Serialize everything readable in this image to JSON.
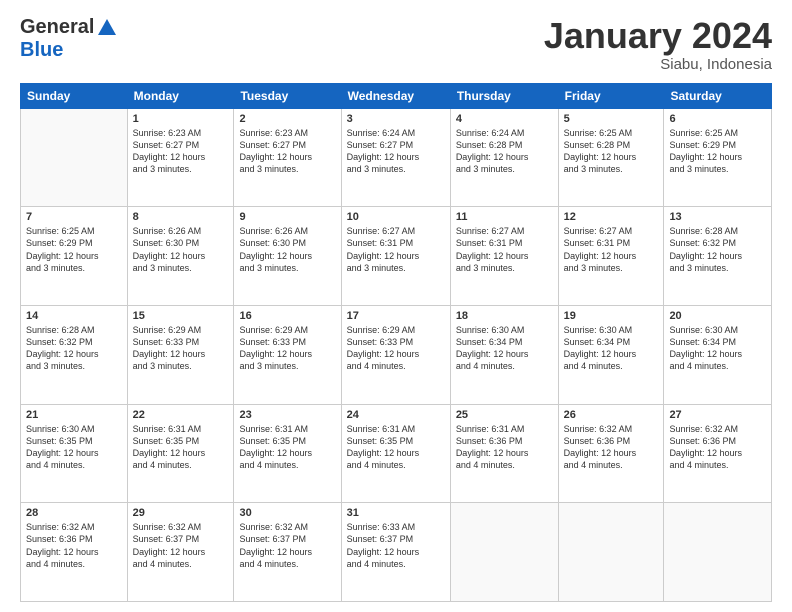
{
  "header": {
    "logo": {
      "general": "General",
      "blue": "Blue"
    },
    "title": "January 2024",
    "location": "Siabu, Indonesia"
  },
  "calendar": {
    "days_of_week": [
      "Sunday",
      "Monday",
      "Tuesday",
      "Wednesday",
      "Thursday",
      "Friday",
      "Saturday"
    ],
    "weeks": [
      [
        {
          "num": "",
          "info": ""
        },
        {
          "num": "1",
          "info": "Sunrise: 6:23 AM\nSunset: 6:27 PM\nDaylight: 12 hours\nand 3 minutes."
        },
        {
          "num": "2",
          "info": "Sunrise: 6:23 AM\nSunset: 6:27 PM\nDaylight: 12 hours\nand 3 minutes."
        },
        {
          "num": "3",
          "info": "Sunrise: 6:24 AM\nSunset: 6:27 PM\nDaylight: 12 hours\nand 3 minutes."
        },
        {
          "num": "4",
          "info": "Sunrise: 6:24 AM\nSunset: 6:28 PM\nDaylight: 12 hours\nand 3 minutes."
        },
        {
          "num": "5",
          "info": "Sunrise: 6:25 AM\nSunset: 6:28 PM\nDaylight: 12 hours\nand 3 minutes."
        },
        {
          "num": "6",
          "info": "Sunrise: 6:25 AM\nSunset: 6:29 PM\nDaylight: 12 hours\nand 3 minutes."
        }
      ],
      [
        {
          "num": "7",
          "info": "Sunrise: 6:25 AM\nSunset: 6:29 PM\nDaylight: 12 hours\nand 3 minutes."
        },
        {
          "num": "8",
          "info": "Sunrise: 6:26 AM\nSunset: 6:30 PM\nDaylight: 12 hours\nand 3 minutes."
        },
        {
          "num": "9",
          "info": "Sunrise: 6:26 AM\nSunset: 6:30 PM\nDaylight: 12 hours\nand 3 minutes."
        },
        {
          "num": "10",
          "info": "Sunrise: 6:27 AM\nSunset: 6:31 PM\nDaylight: 12 hours\nand 3 minutes."
        },
        {
          "num": "11",
          "info": "Sunrise: 6:27 AM\nSunset: 6:31 PM\nDaylight: 12 hours\nand 3 minutes."
        },
        {
          "num": "12",
          "info": "Sunrise: 6:27 AM\nSunset: 6:31 PM\nDaylight: 12 hours\nand 3 minutes."
        },
        {
          "num": "13",
          "info": "Sunrise: 6:28 AM\nSunset: 6:32 PM\nDaylight: 12 hours\nand 3 minutes."
        }
      ],
      [
        {
          "num": "14",
          "info": "Sunrise: 6:28 AM\nSunset: 6:32 PM\nDaylight: 12 hours\nand 3 minutes."
        },
        {
          "num": "15",
          "info": "Sunrise: 6:29 AM\nSunset: 6:33 PM\nDaylight: 12 hours\nand 3 minutes."
        },
        {
          "num": "16",
          "info": "Sunrise: 6:29 AM\nSunset: 6:33 PM\nDaylight: 12 hours\nand 3 minutes."
        },
        {
          "num": "17",
          "info": "Sunrise: 6:29 AM\nSunset: 6:33 PM\nDaylight: 12 hours\nand 4 minutes."
        },
        {
          "num": "18",
          "info": "Sunrise: 6:30 AM\nSunset: 6:34 PM\nDaylight: 12 hours\nand 4 minutes."
        },
        {
          "num": "19",
          "info": "Sunrise: 6:30 AM\nSunset: 6:34 PM\nDaylight: 12 hours\nand 4 minutes."
        },
        {
          "num": "20",
          "info": "Sunrise: 6:30 AM\nSunset: 6:34 PM\nDaylight: 12 hours\nand 4 minutes."
        }
      ],
      [
        {
          "num": "21",
          "info": "Sunrise: 6:30 AM\nSunset: 6:35 PM\nDaylight: 12 hours\nand 4 minutes."
        },
        {
          "num": "22",
          "info": "Sunrise: 6:31 AM\nSunset: 6:35 PM\nDaylight: 12 hours\nand 4 minutes."
        },
        {
          "num": "23",
          "info": "Sunrise: 6:31 AM\nSunset: 6:35 PM\nDaylight: 12 hours\nand 4 minutes."
        },
        {
          "num": "24",
          "info": "Sunrise: 6:31 AM\nSunset: 6:35 PM\nDaylight: 12 hours\nand 4 minutes."
        },
        {
          "num": "25",
          "info": "Sunrise: 6:31 AM\nSunset: 6:36 PM\nDaylight: 12 hours\nand 4 minutes."
        },
        {
          "num": "26",
          "info": "Sunrise: 6:32 AM\nSunset: 6:36 PM\nDaylight: 12 hours\nand 4 minutes."
        },
        {
          "num": "27",
          "info": "Sunrise: 6:32 AM\nSunset: 6:36 PM\nDaylight: 12 hours\nand 4 minutes."
        }
      ],
      [
        {
          "num": "28",
          "info": "Sunrise: 6:32 AM\nSunset: 6:36 PM\nDaylight: 12 hours\nand 4 minutes."
        },
        {
          "num": "29",
          "info": "Sunrise: 6:32 AM\nSunset: 6:37 PM\nDaylight: 12 hours\nand 4 minutes."
        },
        {
          "num": "30",
          "info": "Sunrise: 6:32 AM\nSunset: 6:37 PM\nDaylight: 12 hours\nand 4 minutes."
        },
        {
          "num": "31",
          "info": "Sunrise: 6:33 AM\nSunset: 6:37 PM\nDaylight: 12 hours\nand 4 minutes."
        },
        {
          "num": "",
          "info": ""
        },
        {
          "num": "",
          "info": ""
        },
        {
          "num": "",
          "info": ""
        }
      ]
    ]
  }
}
